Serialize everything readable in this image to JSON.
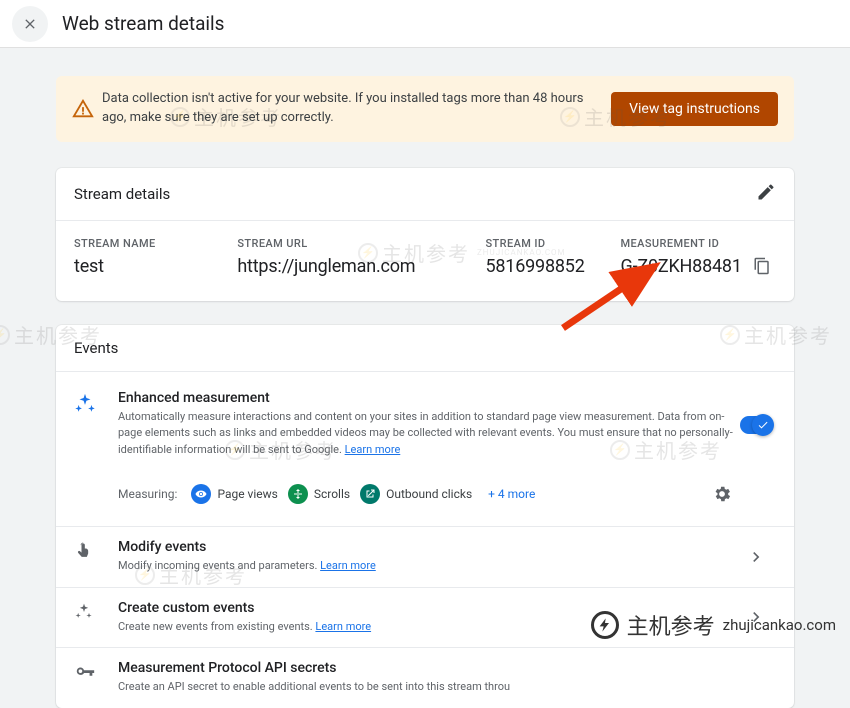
{
  "header": {
    "title": "Web stream details"
  },
  "alert": {
    "text": "Data collection isn't active for your website. If you installed tags more than 48 hours ago, make sure they are set up correctly.",
    "button": "View tag instructions"
  },
  "streamDetails": {
    "title": "Stream details",
    "cols": {
      "nameLabel": "STREAM NAME",
      "nameValue": "test",
      "urlLabel": "STREAM URL",
      "urlValue": "https://jungleman.com",
      "idLabel": "STREAM ID",
      "idValue": "5816998852",
      "midLabel": "MEASUREMENT ID",
      "midValue": "G-Z0ZKH88481"
    }
  },
  "events": {
    "title": "Events",
    "enhanced": {
      "title": "Enhanced measurement",
      "desc": "Automatically measure interactions and content on your sites in addition to standard page view measurement.\nData from on-page elements such as links and embedded videos may be collected with relevant events. You must ensure that no personally-identifiable information will be sent to Google. ",
      "learn": "Learn more",
      "measuringLabel": "Measuring:",
      "chipPageViews": "Page views",
      "chipScrolls": "Scrolls",
      "chipOutbound": "Outbound clicks",
      "more": "+ 4 more"
    },
    "modify": {
      "title": "Modify events",
      "desc": "Modify incoming events and parameters. ",
      "learn": "Learn more"
    },
    "custom": {
      "title": "Create custom events",
      "desc": "Create new events from existing events. ",
      "learn": "Learn more"
    },
    "secrets": {
      "title": "Measurement Protocol API secrets",
      "desc": "Create an API secret to enable additional events to be sent into this stream throu"
    }
  },
  "watermark": {
    "text": "主机参考",
    "sub": "ZHUJICANKAO.COM",
    "url": "zhujicankao.com"
  }
}
